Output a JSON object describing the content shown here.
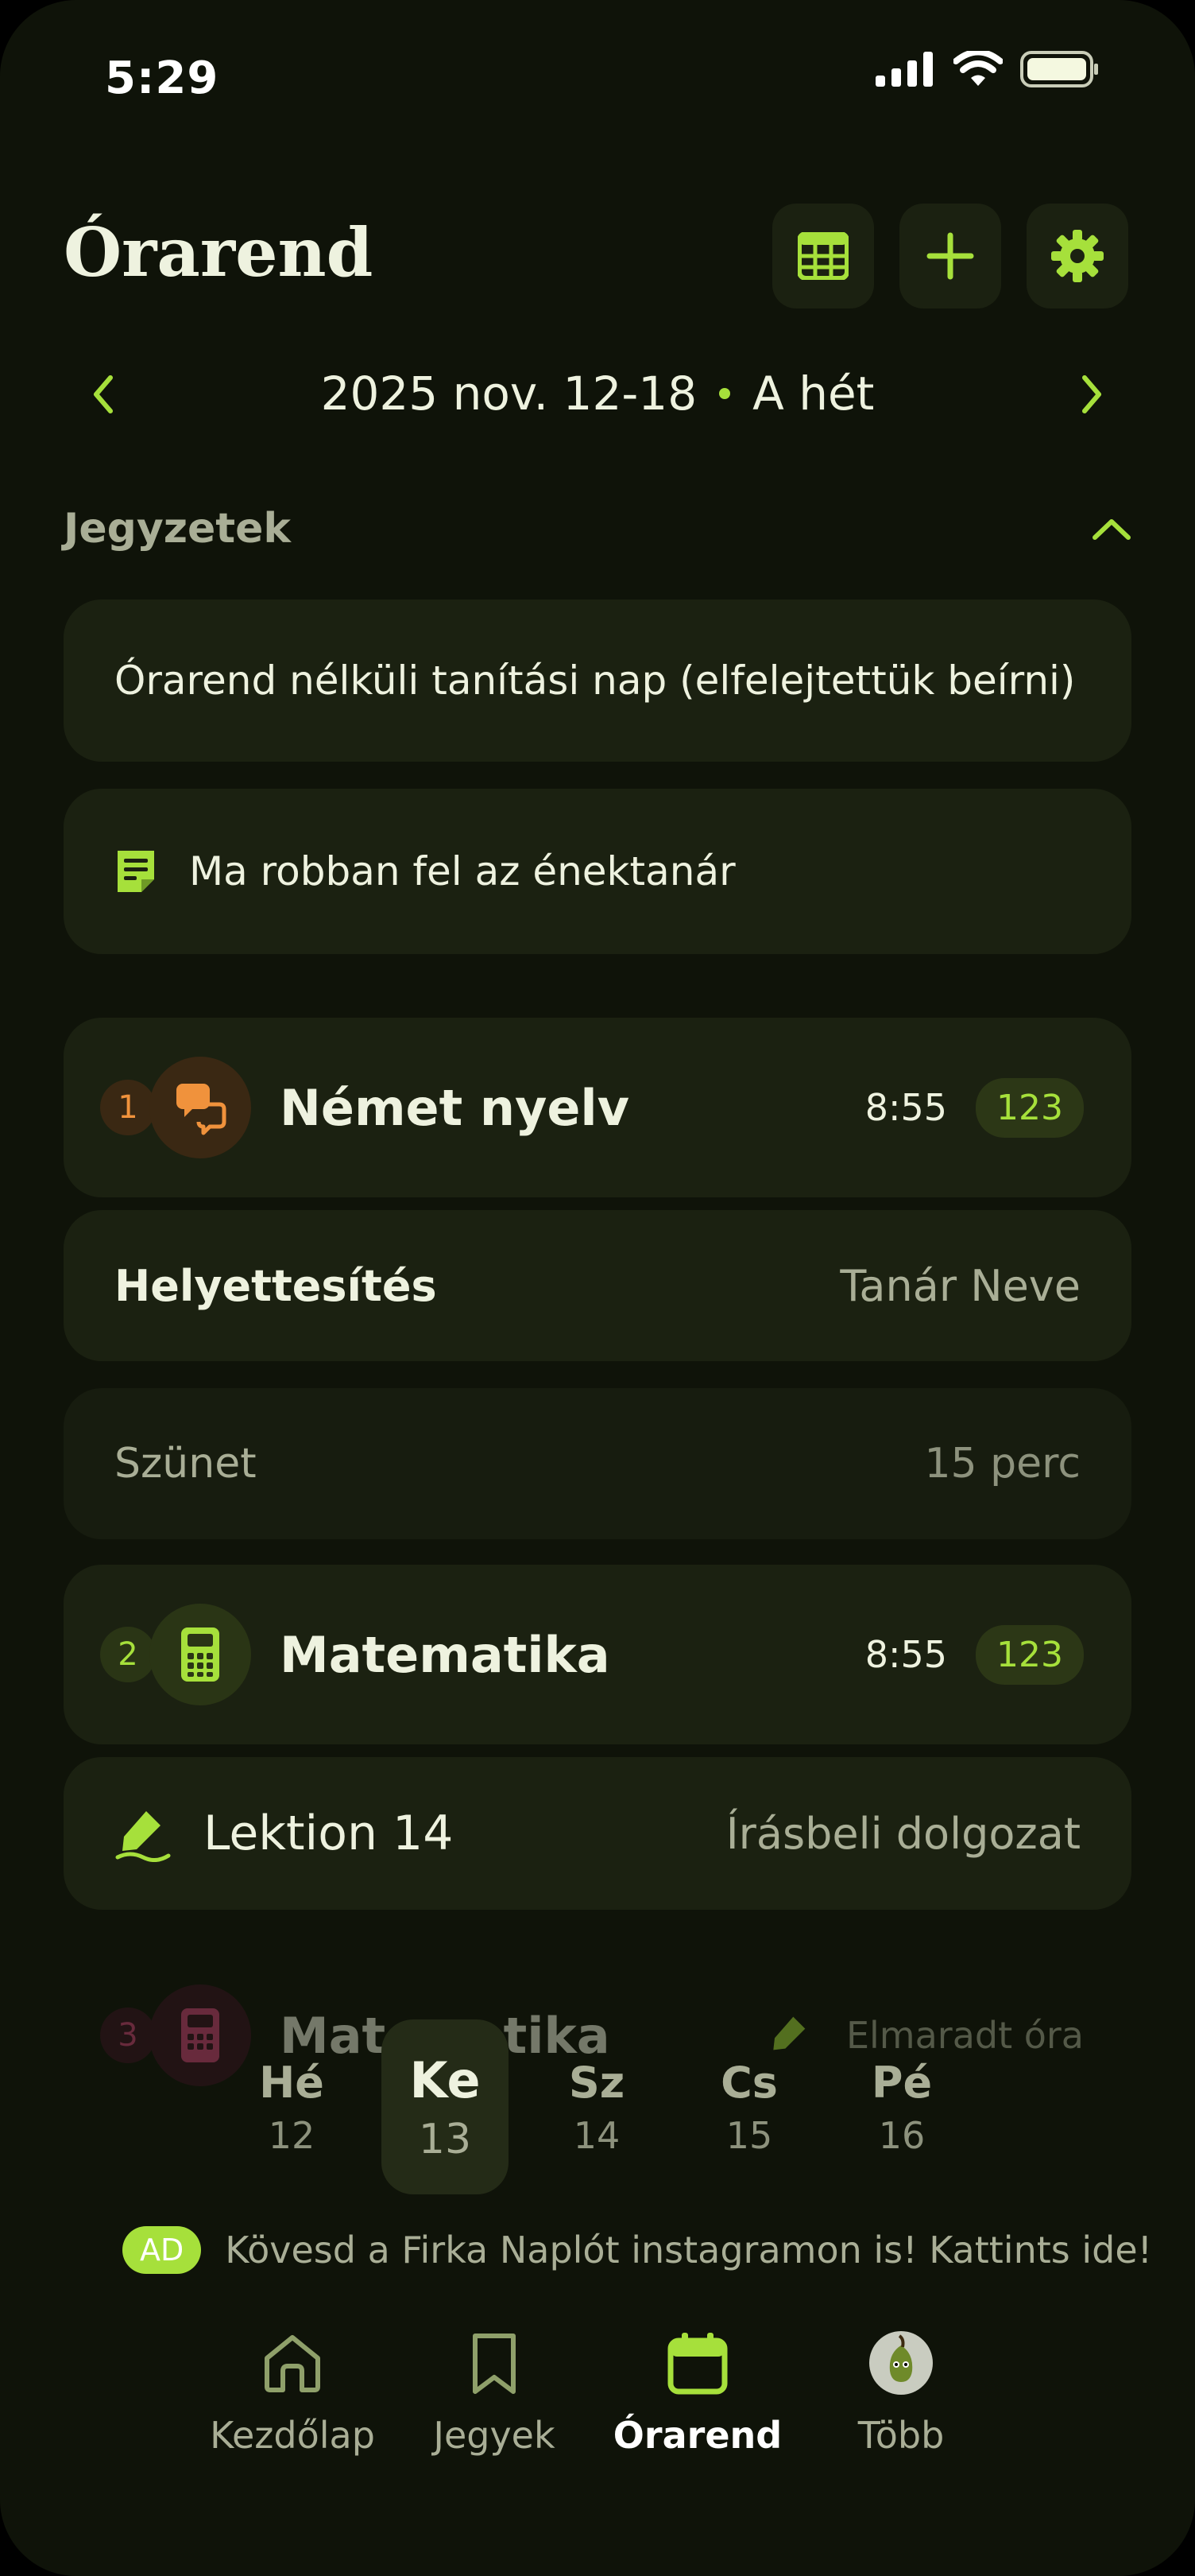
{
  "status": {
    "time": "5:29"
  },
  "header": {
    "title": "Órarend",
    "buttons": [
      "grid-icon",
      "plus-icon",
      "gear-icon"
    ]
  },
  "week": {
    "range": "2025 nov. 12-18",
    "label": "A hét"
  },
  "notes": {
    "section_title": "Jegyzetek",
    "items": [
      {
        "text": "Órarend nélküli tanítási nap (elfelejtettük beírni)"
      },
      {
        "text": "Ma robban fel az énektanár"
      }
    ]
  },
  "lessons": [
    {
      "num": "1",
      "subject": "Német nyelv",
      "time": "8:55",
      "room": "123",
      "icon": "chat-bubbles-icon",
      "color": "#f0923c"
    },
    {
      "num": "2",
      "subject": "Matematika",
      "time": "8:55",
      "room": "123",
      "icon": "calculator-icon",
      "color": "#a6e03b"
    },
    {
      "num": "3",
      "subject": "Matematika",
      "status": "Elmaradt óra",
      "icon": "calculator-icon",
      "color": "#d5467a"
    }
  ],
  "substitution": {
    "label": "Helyettesítés",
    "teacher": "Tanár Neve"
  },
  "break": {
    "label": "Szünet",
    "duration": "15 perc"
  },
  "exam": {
    "title": "Lektion 14",
    "type": "Írásbeli dolgozat"
  },
  "days": [
    {
      "name": "Hé",
      "num": "12"
    },
    {
      "name": "Ke",
      "num": "13",
      "active": true
    },
    {
      "name": "Sz",
      "num": "14"
    },
    {
      "name": "Cs",
      "num": "15"
    },
    {
      "name": "Pé",
      "num": "16"
    }
  ],
  "ad": {
    "badge": "AD",
    "text": "Kövesd a Firka Naplót instagramon is! Kattints ide!"
  },
  "tabs": [
    {
      "label": "Kezdőlap",
      "icon": "home-icon"
    },
    {
      "label": "Jegyek",
      "icon": "bookmark-icon"
    },
    {
      "label": "Órarend",
      "icon": "calendar-icon",
      "active": true
    },
    {
      "label": "Több",
      "icon": "avatar"
    }
  ],
  "colors": {
    "accent": "#a6e03b",
    "background": "#0f1309",
    "card": "#1b2111"
  }
}
